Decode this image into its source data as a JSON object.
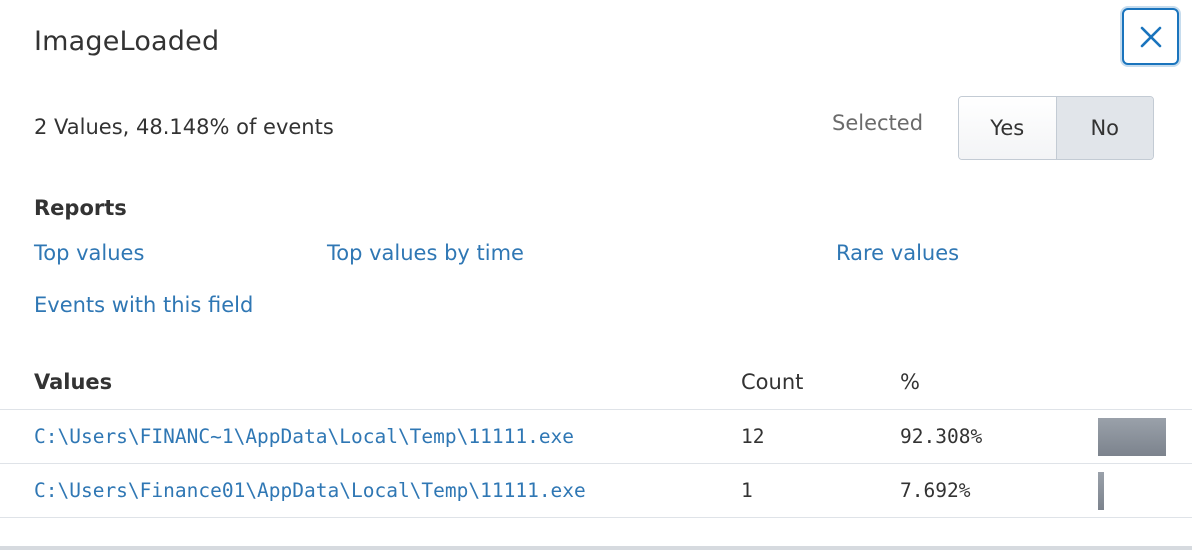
{
  "dialog": {
    "title": "ImageLoaded",
    "close_icon": "close-icon"
  },
  "summary": {
    "text": "2 Values, 48.148% of events"
  },
  "selected": {
    "label": "Selected",
    "yes_label": "Yes",
    "no_label": "No",
    "active": "No"
  },
  "reports": {
    "heading": "Reports",
    "top_values": "Top values",
    "top_values_by_time": "Top values by time",
    "rare_values": "Rare values",
    "events_with_field": "Events with this field"
  },
  "values_table": {
    "headers": {
      "values": "Values",
      "count": "Count",
      "percent": "%"
    },
    "rows": [
      {
        "value": "C:\\Users\\FINANC~1\\AppData\\Local\\Temp\\11111.exe",
        "count": "12",
        "percent": "92.308%",
        "bar_fraction": 0.92308
      },
      {
        "value": "C:\\Users\\Finance01\\AppData\\Local\\Temp\\11111.exe",
        "count": "1",
        "percent": "7.692%",
        "bar_fraction": 0.07692
      }
    ]
  },
  "colors": {
    "link": "#2f77b4",
    "close_border": "#1a74bd",
    "bar": "#8a919a"
  }
}
